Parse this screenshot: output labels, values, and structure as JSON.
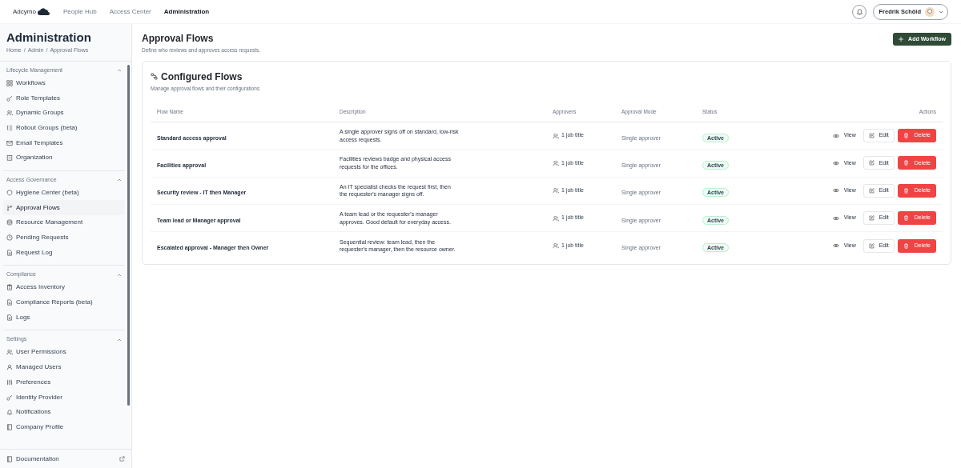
{
  "top_nav": {
    "logo": "Adcymo",
    "links": [
      {
        "label": "People Hub",
        "selected": false
      },
      {
        "label": "Access Center",
        "selected": false
      },
      {
        "label": "Administration",
        "selected": true
      }
    ],
    "user": {
      "name": "Fredrik Schöld"
    }
  },
  "sidebar": {
    "title": "Administration",
    "breadcrumb": [
      "Home",
      "Admin",
      "Approval Flows"
    ],
    "breadcrumb_separator": "/",
    "sections": [
      {
        "title": "Lifecycle Management",
        "expanded": true,
        "items": [
          {
            "label": "Workflows",
            "selected": false
          },
          {
            "label": "Role Templates",
            "selected": false
          },
          {
            "label": "Dynamic Groups",
            "selected": false
          },
          {
            "label": "Rollout Groups (beta)",
            "selected": false
          },
          {
            "label": "Email Templates",
            "selected": false
          },
          {
            "label": "Organization",
            "selected": false
          }
        ]
      },
      {
        "title": "Access Governance",
        "expanded": true,
        "items": [
          {
            "label": "Hygiene Center (beta)",
            "selected": false
          },
          {
            "label": "Approval Flows",
            "selected": true
          },
          {
            "label": "Resource Management",
            "selected": false
          },
          {
            "label": "Pending Requests",
            "selected": false
          },
          {
            "label": "Request Log",
            "selected": false
          }
        ]
      },
      {
        "title": "Compliance",
        "expanded": true,
        "items": [
          {
            "label": "Access Inventory",
            "selected": false
          },
          {
            "label": "Compliance Reports (beta)",
            "selected": false
          },
          {
            "label": "Logs",
            "selected": false
          }
        ]
      },
      {
        "title": "Settings",
        "expanded": true,
        "items": [
          {
            "label": "User Permissions",
            "selected": false
          },
          {
            "label": "Managed Users",
            "selected": false
          },
          {
            "label": "Preferences",
            "selected": false
          },
          {
            "label": "Identity Provider",
            "selected": false
          },
          {
            "label": "Notifications",
            "selected": false
          },
          {
            "label": "Company Profile",
            "selected": false
          }
        ]
      }
    ],
    "footer_link": "Documentation"
  },
  "page": {
    "title": "Approval Flows",
    "subtitle": "Define who reviews and approves access requests.",
    "primary_button": "Add Workflow"
  },
  "card": {
    "title": "Configured Flows",
    "subtitle": "Manage approval flows and their configurations",
    "table": {
      "columns": [
        "Flow Name",
        "Description",
        "Approvers",
        "Approval Mode",
        "Status",
        "Actions"
      ],
      "rows": [
        {
          "name": "Standard access approval",
          "description": "A single approver signs off on standard, low-risk access requests.",
          "approvers": "1 job title",
          "mode": "Single approver",
          "status": "Active",
          "actions": [
            "View",
            "Edit",
            "Delete"
          ]
        },
        {
          "name": "Facilities approval",
          "description": "Facilities reviews badge and physical access requests for the offices.",
          "approvers": "1 job title",
          "mode": "Single approver",
          "status": "Active",
          "actions": [
            "View",
            "Edit",
            "Delete"
          ]
        },
        {
          "name": "Security review - IT then Manager",
          "description": "An IT specialist checks the request first, then the requester's manager signs off.",
          "approvers": "1 job title",
          "mode": "Single approver",
          "status": "Active",
          "actions": [
            "View",
            "Edit",
            "Delete"
          ]
        },
        {
          "name": "Team lead or Manager approval",
          "description": "A team lead or the requester's manager approves. Good default for everyday access.",
          "approvers": "1 job title",
          "mode": "Single approver",
          "status": "Active",
          "actions": [
            "View",
            "Edit",
            "Delete"
          ]
        },
        {
          "name": "Escalated approval - Manager then Owner",
          "description": "Sequential review: team lead, then the requester's manager, then the resource owner.",
          "approvers": "1 job title",
          "mode": "Single approver",
          "status": "Active",
          "actions": [
            "View",
            "Edit",
            "Delete"
          ]
        }
      ]
    }
  }
}
